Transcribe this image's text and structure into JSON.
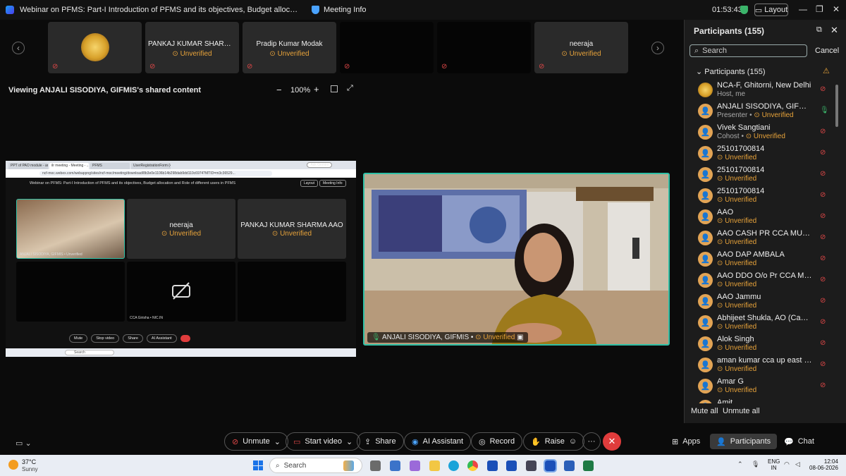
{
  "window": {
    "title": "Webinar on PFMS: Part-I Introduction of PFMS and its objectives, Budget allocation and Role of different users in PF...",
    "meeting_info": "Meeting Info",
    "clock": "01:53:43",
    "layout_label": "Layout",
    "minimize": "—",
    "restore": "❐",
    "close": "✕"
  },
  "filmstrip": {
    "prev": "‹",
    "next": "›",
    "tiles": [
      {
        "name": "",
        "status": "",
        "logo_text": "NCA"
      },
      {
        "name": "PANKAJ KUMAR SHARMA A...",
        "status": "Unverified"
      },
      {
        "name": "Pradip Kumar Modak",
        "status": "Unverified"
      },
      {
        "name": "",
        "status": ""
      },
      {
        "name": "",
        "status": ""
      },
      {
        "name": "neeraja",
        "status": "Unverified"
      }
    ]
  },
  "share_bar": {
    "viewing_text": "Viewing ANJALI SISODIYA, GIFMIS's shared content",
    "zoom_out": "−",
    "zoom_level": "100%",
    "zoom_in": "+"
  },
  "shared_screen": {
    "tabs": [
      "PPT of PAO module - anjali...",
      "ilr meeting - Meeting - ...",
      "PFMS",
      "UserRegistrationForm (4).pdf"
    ],
    "gemini": "Ask Gemini",
    "url": "ncf-moc.webex.com/webappng/sites/ncf-moc/meeting/download/8b3e0e1106b14b298dab9dd110c6974?MTID=m3c36529...",
    "meeting_title": "Webinar on PFMS: Part-I Introduction of PFMS and its objectives, Budget allocation and Role of different users in PFMS",
    "layout": "Layout",
    "meeting_info": "Meeting Info",
    "tiles": [
      {
        "name": "",
        "status": "",
        "label": "ANJALI SISODIYA, GIFMIS • Unverified"
      },
      {
        "name": "neeraja",
        "status": "Unverified",
        "label": ""
      },
      {
        "name": "PANKAJ KUMAR SHARMA AAO",
        "status": "Unverified",
        "label": ""
      },
      {
        "name": "",
        "status": "",
        "label": ""
      },
      {
        "name": "",
        "status": "",
        "label": "CCA Girisha • NIC.IN"
      },
      {
        "name": "",
        "status": "",
        "label": ""
      }
    ],
    "toolbar": {
      "mute": "Mute",
      "stop_video": "Stop video",
      "share": "Share",
      "ai": "AI Assistant"
    },
    "taskbar_search": "Search"
  },
  "main_video": {
    "name": "ANJALI SISODIYA, GIFMIS •",
    "status": "Unverified"
  },
  "participants_panel": {
    "title": "Participants (155)",
    "search_placeholder": "Search",
    "cancel": "Cancel",
    "group_label": "Participants (155)",
    "mute_all": "Mute all",
    "unmute_all": "Unmute all",
    "items": [
      {
        "name": "NCA-F, Ghitorni, New Delhi",
        "sub": "Host, me",
        "status": "",
        "mic": "muted"
      },
      {
        "name": "ANJALI SISODIYA, GIFMIS",
        "sub": "Presenter •",
        "status": "Unverified",
        "mic": "on"
      },
      {
        "name": "Vivek Sangtiani",
        "sub": "Cohost •",
        "status": "Unverified",
        "mic": "muted"
      },
      {
        "name": "25101700814",
        "sub": "",
        "status": "Unverified",
        "mic": "muted"
      },
      {
        "name": "25101700814",
        "sub": "",
        "status": "Unverified",
        "mic": "muted"
      },
      {
        "name": "25101700814",
        "sub": "",
        "status": "Unverified",
        "mic": "muted"
      },
      {
        "name": "AAO",
        "sub": "",
        "status": "Unverified",
        "mic": "muted"
      },
      {
        "name": "AAO CASH PR CCA MUMBAI",
        "sub": "",
        "status": "Unverified",
        "mic": "muted"
      },
      {
        "name": "AAO DAP AMBALA",
        "sub": "",
        "status": "Unverified",
        "mic": "muted"
      },
      {
        "name": "AAO DDO O/o Pr CCA Mumbai",
        "sub": "",
        "status": "Unverified",
        "mic": "muted"
      },
      {
        "name": "AAO Jammu",
        "sub": "",
        "status": "Unverified",
        "mic": "muted"
      },
      {
        "name": "Abhijeet Shukla, AO (Cash), O...",
        "sub": "",
        "status": "Unverified",
        "mic": "muted"
      },
      {
        "name": "Alok Singh",
        "sub": "",
        "status": "Unverified",
        "mic": "muted"
      },
      {
        "name": "aman kumar cca up east luck...",
        "sub": "",
        "status": "Unverified",
        "mic": "muted"
      },
      {
        "name": "Amar G",
        "sub": "",
        "status": "Unverified",
        "mic": "muted"
      },
      {
        "name": "Amit",
        "sub": "",
        "status": "",
        "mic": "muted"
      }
    ]
  },
  "controls": {
    "unmute": "Unmute",
    "start_video": "Start video",
    "share": "Share",
    "ai_assistant": "AI Assistant",
    "record": "Record",
    "raise": "Raise",
    "more": "···",
    "apps": "Apps",
    "participants": "Participants",
    "chat": "Chat"
  },
  "taskbar": {
    "temperature": "37°C",
    "weather": "Sunny",
    "search": "Search",
    "lang_top": "ENG",
    "lang_bottom": "IN",
    "time": "12:04",
    "date": "08-06-2026"
  },
  "colors": {
    "accent_teal": "#2fc0a6",
    "unverified": "#e8a33a",
    "muted_red": "#e24848",
    "end_call": "#e03c3c"
  }
}
